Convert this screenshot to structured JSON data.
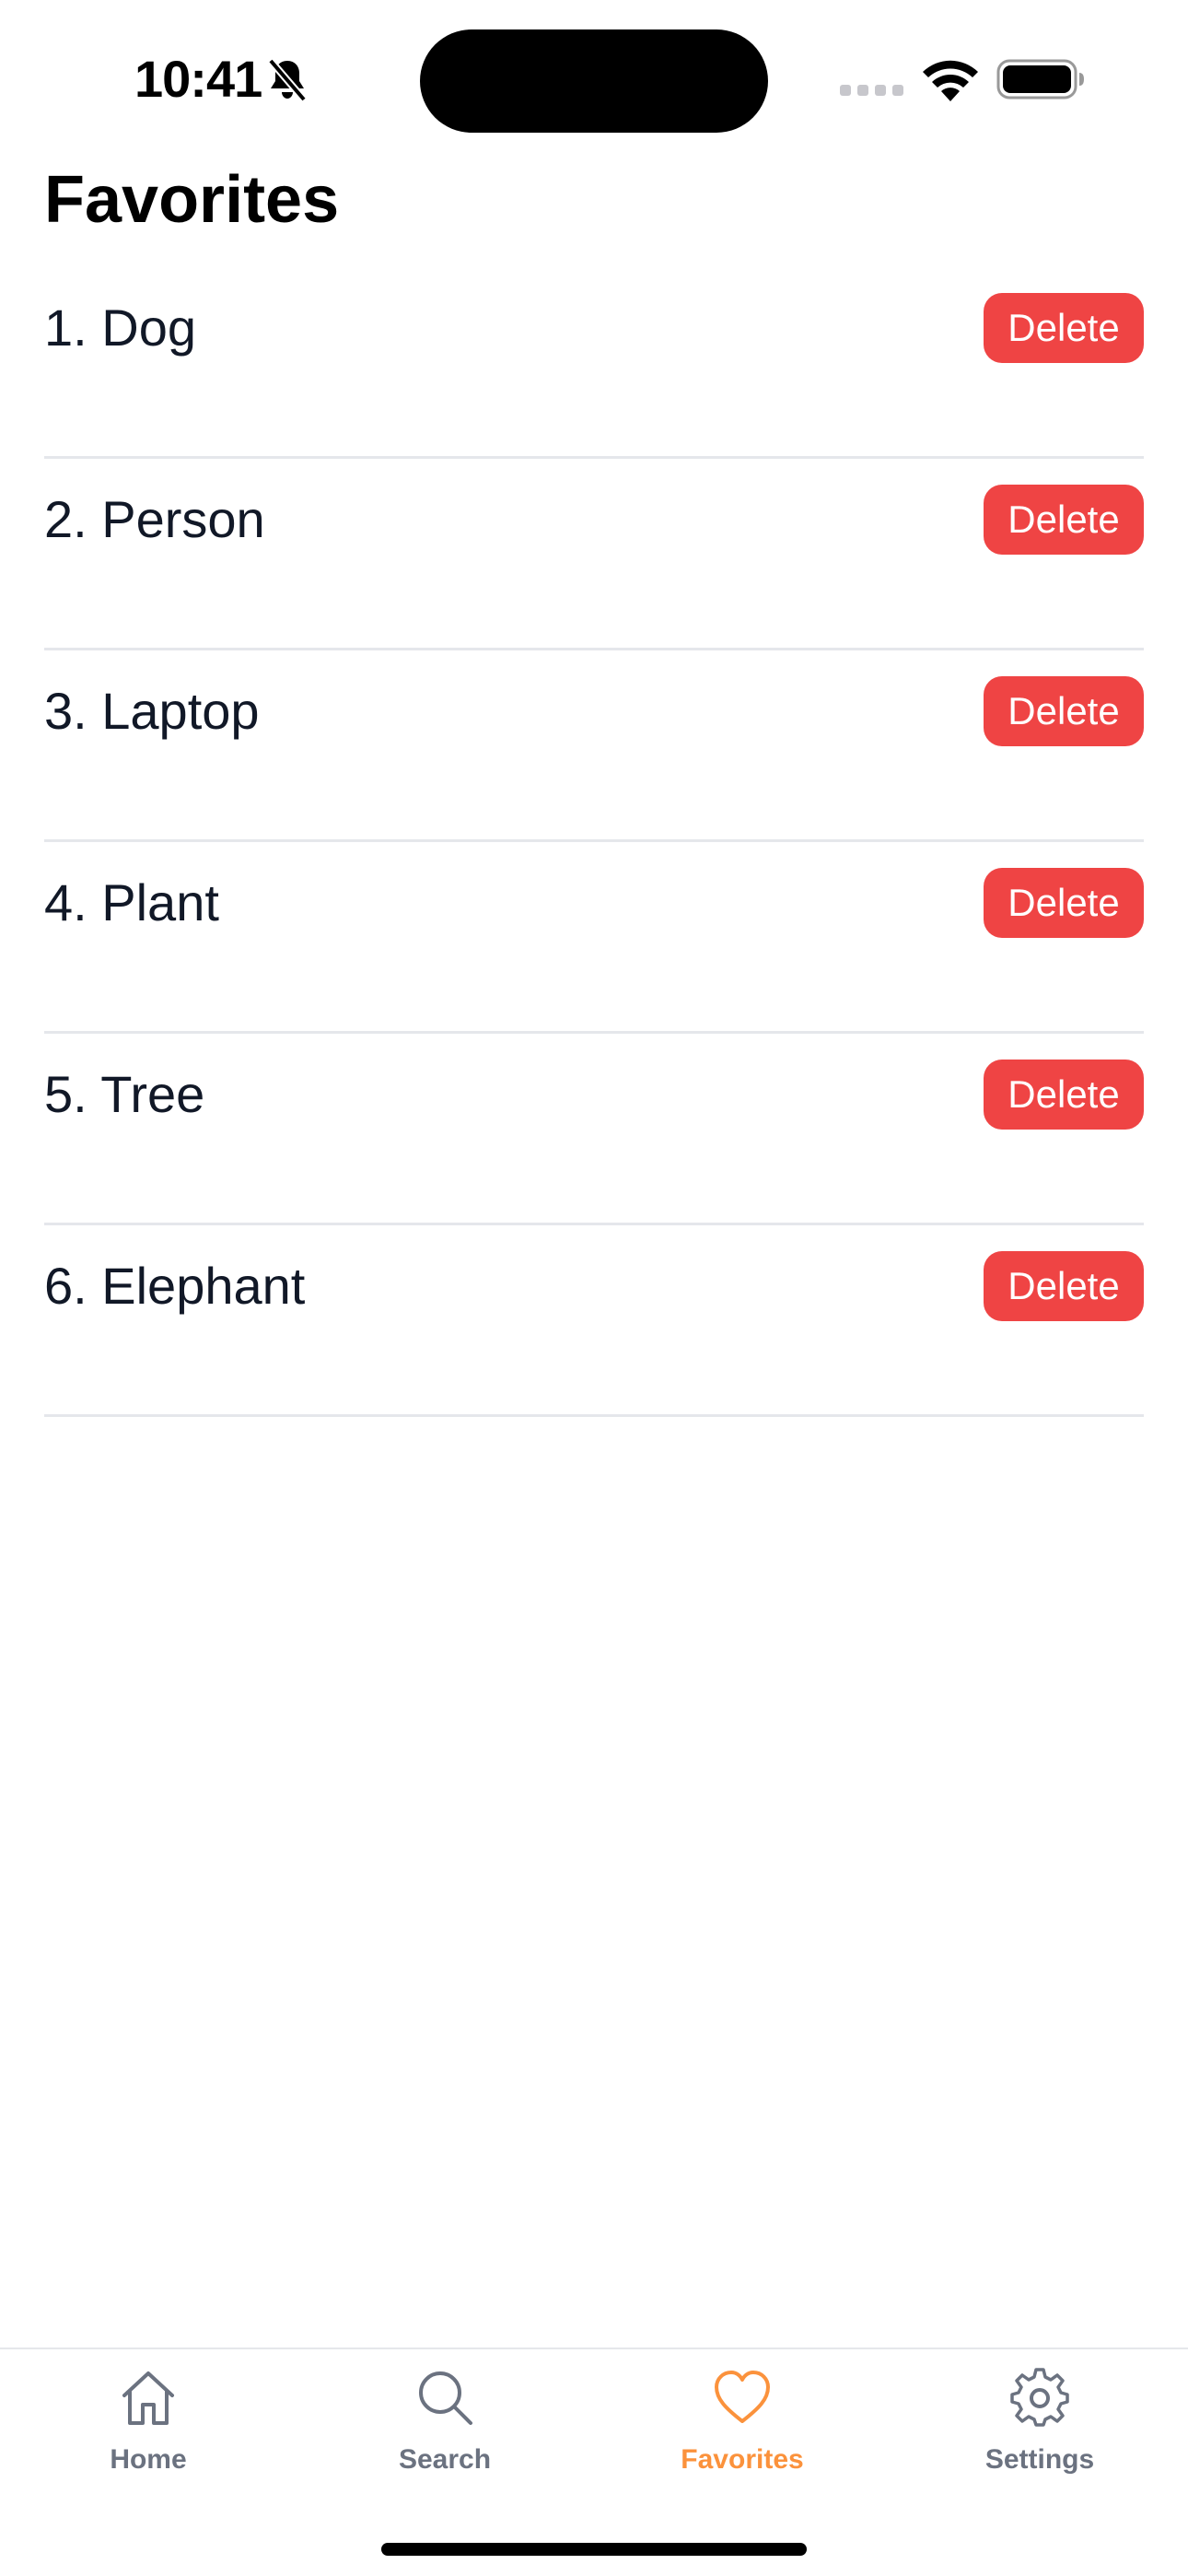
{
  "status_bar": {
    "time": "10:41",
    "icons": [
      "bell-slash-icon",
      "signal-icon",
      "wifi-icon",
      "battery-icon"
    ]
  },
  "header": {
    "title": "Favorites"
  },
  "favorites": {
    "items": [
      {
        "label": "1. Dog",
        "delete_label": "Delete"
      },
      {
        "label": "2. Person",
        "delete_label": "Delete"
      },
      {
        "label": "3. Laptop",
        "delete_label": "Delete"
      },
      {
        "label": "4. Plant",
        "delete_label": "Delete"
      },
      {
        "label": "5. Tree",
        "delete_label": "Delete"
      },
      {
        "label": "6. Elephant",
        "delete_label": "Delete"
      }
    ]
  },
  "tab_bar": {
    "tabs": [
      {
        "label": "Home",
        "icon": "home-icon",
        "active": false
      },
      {
        "label": "Search",
        "icon": "search-icon",
        "active": false
      },
      {
        "label": "Favorites",
        "icon": "heart-icon",
        "active": true
      },
      {
        "label": "Settings",
        "icon": "gear-icon",
        "active": false
      }
    ]
  },
  "colors": {
    "delete": "#ef4444",
    "accent": "#fb923c",
    "inactive": "#6b7280",
    "text": "#111827",
    "divider": "#e5e7eb"
  }
}
